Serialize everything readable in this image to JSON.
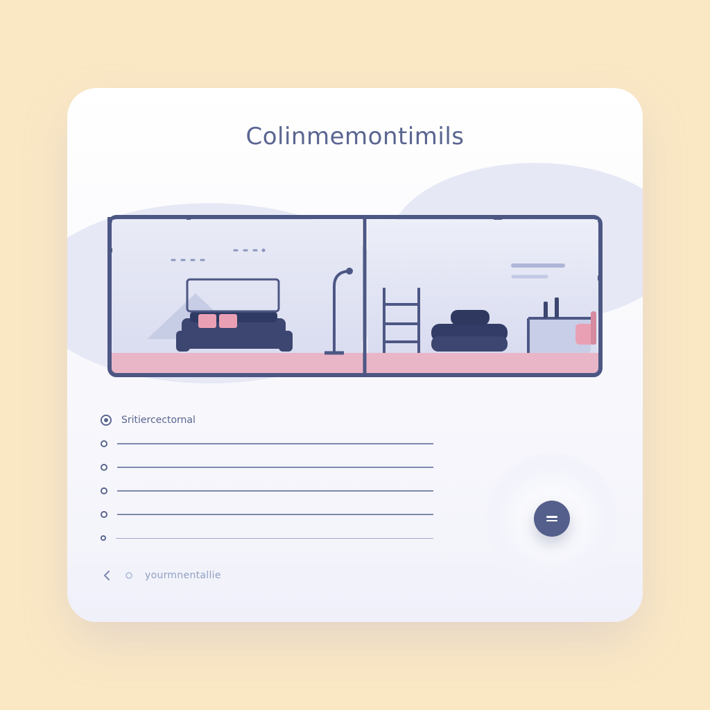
{
  "page": {
    "title": "Colinmemontimils"
  },
  "form": {
    "first_label": "Sritiercectornal",
    "rows": 6
  },
  "footer": {
    "caption": "yourmnentallie"
  },
  "fab": {
    "name": "equals"
  },
  "colors": {
    "background": "#fae8c5",
    "card": "#ffffff",
    "ink": "#3f4a72",
    "accent_floor": "#e9b6c7",
    "accent_pink": "#eaa0b4",
    "lavender": "#e6e8f5"
  }
}
